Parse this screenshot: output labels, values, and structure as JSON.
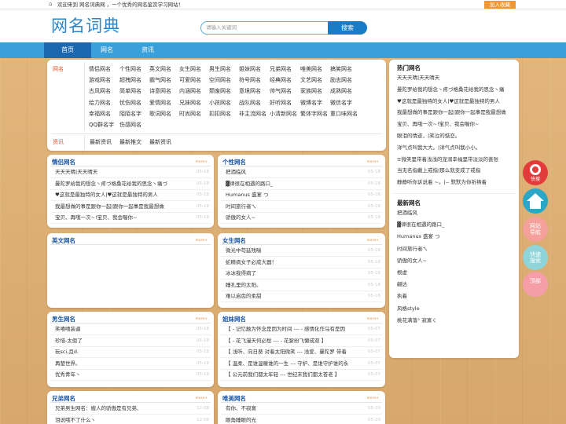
{
  "topbar": {
    "welcome": "欢迎来到 网名词典网 ，一个优秀的网名鉴赏学习网站！",
    "favorite": "加入收藏",
    "home_icon": "home-icon"
  },
  "header": {
    "logo": "网名词典",
    "search_placeholder": "请输入关键词",
    "search_button": "搜索"
  },
  "nav": {
    "items": [
      "首页",
      "网名",
      "资讯"
    ]
  },
  "categories": {
    "label": "网名",
    "rows": [
      [
        "情侣网名",
        "个性网名",
        "英文网名",
        "女生网名",
        "男生网名",
        "姐妹网名",
        "兄弟网名",
        "唯美网名",
        "搞笑网名"
      ],
      [
        "游戏网名",
        "超拽网名",
        "霸气网名",
        "可爱网名",
        "空间网名",
        "符号网名",
        "经典网名",
        "文艺网名",
        "励志网名"
      ],
      [
        "古风网名",
        "简单网名",
        "诗意网名",
        "内涵网名",
        "颓废网名",
        "意境网名",
        "帅气网名",
        "家族网名",
        "成熟网名"
      ],
      [
        "给力网名",
        "忧伤网名",
        "爱情网名",
        "兄妹网名",
        "小孩网名",
        "战队网名",
        "好听网名",
        "微博名字",
        "微信名字"
      ],
      [
        "幸福网名",
        "陌陌名字",
        "歌词网名",
        "时尚网名",
        "扣扣网名",
        "非主流网名",
        "小清新网名",
        "繁体字网名",
        "重口味网名"
      ],
      [
        "QQ群名字",
        "伤感网名"
      ]
    ],
    "news_label": "资讯",
    "news_links": [
      "最新资讯",
      "最新推文",
      "最新资讯"
    ]
  },
  "panels": [
    {
      "title": "情侣网名",
      "more": "more+",
      "items": [
        {
          "t": "天天天晴|天天晴天",
          "d": "05-18"
        },
        {
          "t": "曼陀罗给我的想念丶疼づ格桑花给我的思念丶痛づ",
          "d": "05-18"
        },
        {
          "t": "♥这就是最独特的女人|♥这就是最独特的男人",
          "d": "05-18"
        },
        {
          "t": "我最想做的事是跟你一起|跟你一起事是我最想做",
          "d": "05-18"
        },
        {
          "t": "宝贝、再哦一次~!宝贝、我会喔你~",
          "d": "05-18"
        }
      ]
    },
    {
      "title": "个性网名",
      "more": "more+",
      "items": [
        {
          "t": "把酒临风",
          "d": "05-18"
        },
        {
          "t": "▓律很在相遇的路口_",
          "d": "05-18"
        },
        {
          "t": "Humanus 盛宴 つ",
          "d": "05-18"
        },
        {
          "t": "时间旅行者ㄟ",
          "d": "05-18"
        },
        {
          "t": "骄傲的女人~",
          "d": "05-18"
        }
      ]
    },
    {
      "title": "英文网名",
      "more": "more+",
      "items": []
    },
    {
      "title": "女生网名",
      "more": "more+",
      "items": [
        {
          "t": "微光中苟延残喘",
          "d": "05-18"
        },
        {
          "t": "蛇精病女子必成大器！",
          "d": "05-18"
        },
        {
          "t": "冰冰我得病了",
          "d": "05-18"
        },
        {
          "t": "睡孔里的太阳。",
          "d": "05-18"
        },
        {
          "t": "难以启齿的柔甜",
          "d": "05-18"
        }
      ]
    },
    {
      "title": "男生网名",
      "more": "more+",
      "items": [
        {
          "t": "笑嘻嘻装逼",
          "d": "05-18"
        },
        {
          "t": "珍惜-太假了",
          "d": "05-18"
        },
        {
          "t": "玩sci,且d.",
          "d": "05-18"
        },
        {
          "t": "再楚世界。",
          "d": "05-18"
        },
        {
          "t": "优秀青年丶",
          "d": "05-18"
        }
      ]
    },
    {
      "title": "姐妹网名",
      "more": "more+",
      "items": [
        {
          "t": "【 - 记忆触为怀念是因为时间 --- - 感情化作乌有是因",
          "d": "05-07"
        },
        {
          "t": "【 - 花飞漫天何必愁 --- - 花絮纷飞懒成双 】",
          "d": "05-07"
        },
        {
          "t": "【 浅听、向日葵 对着太阳微笑 --- 浅爱、曼陀罗 带着",
          "d": "05-07"
        },
        {
          "t": "【 温柔、是谁温暖谁的一生 --- 守护、是谁守护谁的永",
          "d": "05-07"
        },
        {
          "t": "【 公元前我们都太年轻 --- 世纪末我们都太苍老 】",
          "d": "05-07"
        }
      ]
    },
    {
      "title": "兄弟网名",
      "more": "more+",
      "items": [
        {
          "t": "兄弟男生网名：嫂人的骄傲是有兄弟、",
          "d": "12-08"
        },
        {
          "t": "泪说哦不了什么丶",
          "d": "12-08"
        }
      ]
    },
    {
      "title": "唯美网名",
      "more": "more+",
      "items": [
        {
          "t": "有你、不寂寞",
          "d": "05-20"
        },
        {
          "t": "眼角睡眼的光",
          "d": "05-20"
        }
      ]
    }
  ],
  "sidebar": {
    "hot_title": "热门网名",
    "hot": [
      "天天天晴|天天晴天",
      "曼陀罗给我的想念丶疼づ格桑花给我的思念丶痛",
      "♥这就是最独特的女人|♥这就是最独特的男人",
      "我最想做的事是跟你一起|跟你一起事是我最想做",
      "宝贝、再哦一次~!宝贝、我会喔你~",
      "眼泪的情迹，|笑泣的惦恋。",
      "洋气点叫我大大。|洋气点叫我小小。",
      "≡微笑里带着浅浅的宠溺幸福里带淡淡的善张",
      "当无名指戴上戒指|那么就变成了戒指",
      "静静听你诉说着 ~。|-- 默默为你祈祷着"
    ],
    "new_title": "最新网名",
    "new": [
      "把酒临风",
      "▓律很在相遇的路口_",
      "Humanus 盛宴 つ",
      "时间旅行者ㄟ",
      "骄傲的女人~",
      "根虚",
      "翩达",
      "执着",
      "风格style",
      "桃花满落° 寂寞く"
    ]
  },
  "floating": [
    {
      "label": "快搜",
      "icon": "search-icon",
      "color": "#e23b3b"
    },
    {
      "label": "",
      "icon": "home-icon",
      "color": "#2aa7c7"
    },
    {
      "label": "网站导航",
      "icon": "",
      "color": "#f5a09a"
    },
    {
      "label": "快速搜索",
      "icon": "",
      "color": "#8fd4d8"
    },
    {
      "label": "顶部",
      "icon": "",
      "color": "#f59ea8"
    }
  ]
}
